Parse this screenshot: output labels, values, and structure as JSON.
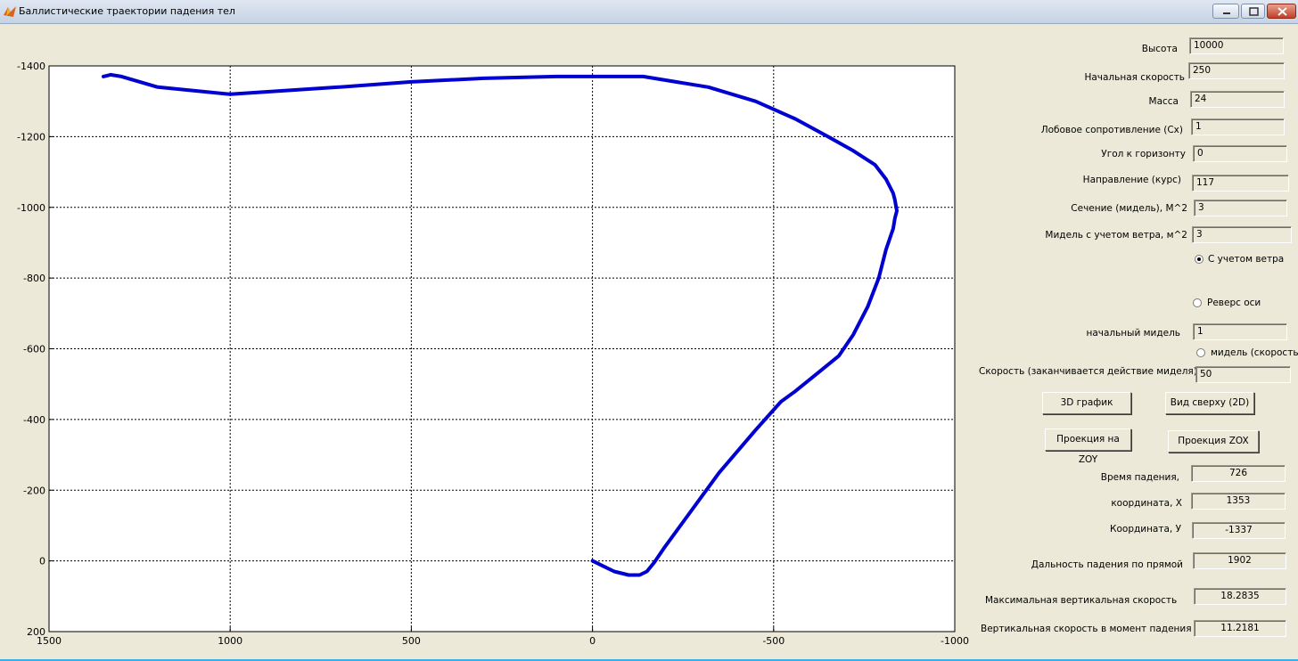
{
  "window": {
    "title": "Баллистические траектории падения тел"
  },
  "inputs": {
    "height": {
      "label": "Высота",
      "value": "10000"
    },
    "initial_speed": {
      "label": "Начальная скорость",
      "value": "250"
    },
    "mass": {
      "label": "Масса",
      "value": "24"
    },
    "drag": {
      "label": "Лобовое сопротивление (Cx)",
      "value": "1"
    },
    "angle": {
      "label": "Угол к горизонту",
      "value": "0"
    },
    "direction": {
      "label": "Направление  (курс)",
      "value": "117"
    },
    "section": {
      "label": "Сечение (мидель), М^2",
      "value": "3"
    },
    "midel_wind": {
      "label": "Мидель с учетом ветра, м^2",
      "value": "3"
    },
    "initial_midel": {
      "label": "начальный мидель",
      "value": "1"
    },
    "speed_end": {
      "label": "Скорость (заканчивается действие миделя)",
      "value": "50"
    }
  },
  "radios": {
    "wind": {
      "label": "С учетом ветра",
      "checked": true
    },
    "reverse_axis": {
      "label": "Реверс оси",
      "checked": false
    },
    "midel_speed": {
      "label": "мидель (скорость)",
      "checked": false
    }
  },
  "buttons": {
    "graph3d": "3D график",
    "top_view": "Вид сверху (2D)",
    "proj_zoy": "Проекция на ZOY",
    "proj_zox": "Проекция ZOX"
  },
  "outputs": {
    "fall_time": {
      "label": "Время падения,",
      "value": "726"
    },
    "coord_x": {
      "label": "координата, Х",
      "value": "1353"
    },
    "coord_y": {
      "label": "Координата, У",
      "value": "-1337"
    },
    "range": {
      "label": "Дальность падения по прямой",
      "value": "1902"
    },
    "max_vspeed": {
      "label": "Максимальная вертикальная скорость",
      "value": "18.2835"
    },
    "vspeed_impact": {
      "label": "Вертикальная  скорость в момент падения",
      "value": "11.2181"
    }
  },
  "colors": {
    "line": "#0000d0",
    "background": "#ece9d8"
  },
  "chart_data": {
    "type": "line",
    "title": "",
    "xlabel": "",
    "ylabel": "",
    "xlim": [
      1500,
      -1000
    ],
    "ylim": [
      200,
      -1400
    ],
    "x_reversed": true,
    "y_reversed": true,
    "grid": true,
    "xticks": [
      1500,
      1000,
      500,
      0,
      -500,
      -1000
    ],
    "yticks": [
      -1400,
      -1200,
      -1000,
      -800,
      -600,
      -400,
      -200,
      0,
      200
    ],
    "series": [
      {
        "name": "",
        "color": "#0000d0",
        "x": [
          0,
          -30,
          -60,
          -100,
          -130,
          -150,
          -170,
          -200,
          -250,
          -300,
          -350,
          -400,
          -450,
          -520,
          -560,
          -620,
          -680,
          -720,
          -760,
          -790,
          -810,
          -830,
          -835,
          -840,
          -835,
          -830,
          -810,
          -780,
          -720,
          -650,
          -560,
          -450,
          -320,
          -200,
          -140,
          -50,
          0,
          100,
          300,
          500,
          700,
          1000,
          1200,
          1300,
          1330,
          1350
        ],
        "y": [
          0,
          15,
          30,
          40,
          40,
          30,
          5,
          -40,
          -110,
          -180,
          -250,
          -310,
          -370,
          -450,
          -480,
          -530,
          -580,
          -640,
          -720,
          -800,
          -880,
          -940,
          -970,
          -990,
          -1020,
          -1040,
          -1080,
          -1120,
          -1160,
          -1200,
          -1250,
          -1300,
          -1340,
          -1360,
          -1370,
          -1370,
          -1370,
          -1370,
          -1365,
          -1355,
          -1340,
          -1320,
          -1340,
          -1370,
          -1375,
          -1370
        ]
      }
    ]
  }
}
